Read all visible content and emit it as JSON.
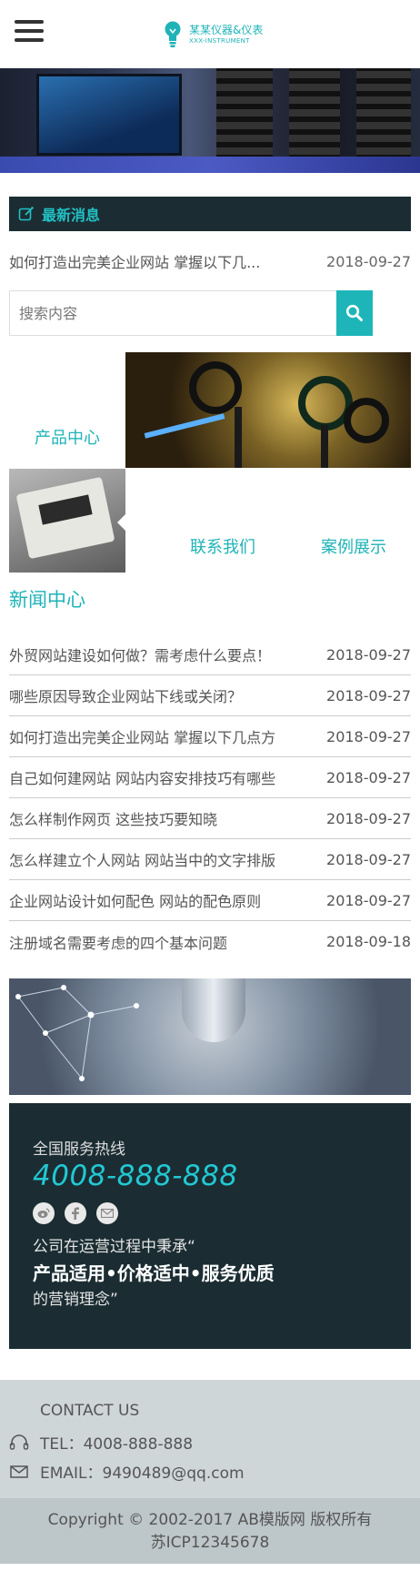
{
  "header": {
    "logo_main": "某某仪器&仪表",
    "logo_sub": "XXX-INSTRUMENT"
  },
  "latest_news": {
    "section_title": "最新消息",
    "item_title": "如何打造出完美企业网站 掌握以下几...",
    "item_date": "2018-09-27"
  },
  "search": {
    "placeholder": "搜索内容"
  },
  "categories": {
    "products": "产品中心",
    "contact": "联系我们",
    "cases": "案例展示"
  },
  "news_center": {
    "title": "新闻中心",
    "items": [
      {
        "title": "外贸网站建设如何做？需考虑什么要点！",
        "date": "2018-09-27"
      },
      {
        "title": "哪些原因导致企业网站下线或关闭？",
        "date": "2018-09-27"
      },
      {
        "title": "如何打造出完美企业网站 掌握以下几点方",
        "date": "2018-09-27"
      },
      {
        "title": "自己如何建网站 网站内容安排技巧有哪些",
        "date": "2018-09-27"
      },
      {
        "title": "怎么样制作网页 这些技巧要知晓",
        "date": "2018-09-27"
      },
      {
        "title": "怎么样建立个人网站 网站当中的文字排版",
        "date": "2018-09-27"
      },
      {
        "title": "企业网站设计如何配色 网站的配色原则",
        "date": "2018-09-27"
      },
      {
        "title": "注册域名需要考虑的四个基本问题",
        "date": "2018-09-18"
      }
    ]
  },
  "hotline": {
    "label": "全国服务热线",
    "phone": "4008-888-888",
    "line1": "公司在运营过程中秉承“",
    "line2": "产品适用•价格适中•服务优质",
    "line3": "的营销理念”"
  },
  "contact": {
    "title": "CONTACT US",
    "tel": "TEL：4008-888-888",
    "email": "EMAIL：9490489@qq.com"
  },
  "footer": {
    "copyright": "Copyright © 2002-2017 AB模版网 版权所有",
    "icp": "苏ICP12345678"
  },
  "colors": {
    "accent": "#1fb3b8",
    "dark_panel": "#1b2d33",
    "contact_bg": "#cfd6d8",
    "footer_bg": "#bdc6c9"
  },
  "icons": [
    "menu-icon",
    "lightbulb-logo-icon",
    "edit-icon",
    "search-icon",
    "weibo-icon",
    "facebook-icon",
    "mail-icon",
    "headset-icon",
    "envelope-icon"
  ]
}
